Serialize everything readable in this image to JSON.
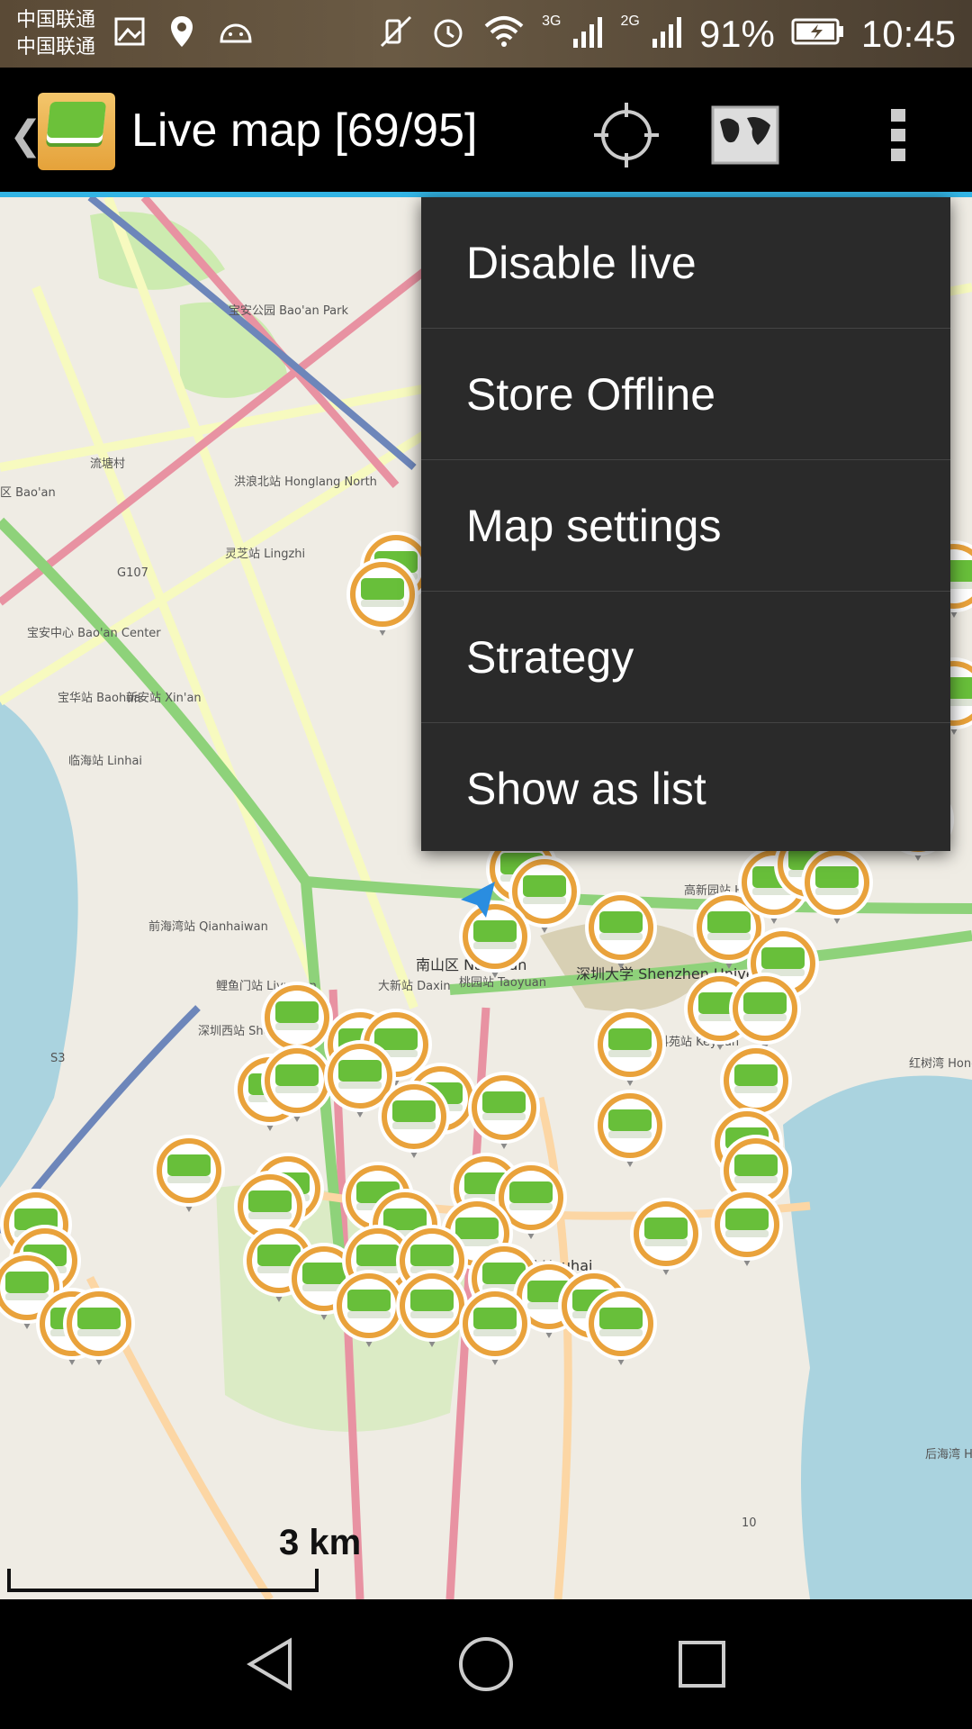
{
  "status_bar": {
    "carrier_line1": "中国联通",
    "carrier_line2": "中国联通",
    "network_3g": "3G",
    "network_2g": "2G",
    "battery": "91%",
    "time": "10:45",
    "icons_left": [
      "gallery-icon",
      "location-pin-icon",
      "android-icon"
    ],
    "icons_right": [
      "mute-icon",
      "alarm-icon",
      "wifi-icon",
      "signal-3g-icon",
      "signal-2g-icon",
      "battery-icon"
    ]
  },
  "action_bar": {
    "title": "Live map [69/95]",
    "icons": [
      "back-caret-icon",
      "app-logo-icon",
      "my-location-icon",
      "map-source-icon",
      "overflow-menu-icon"
    ]
  },
  "overflow_menu": {
    "items": [
      {
        "label": "Disable live"
      },
      {
        "label": "Store Offline"
      },
      {
        "label": "Map settings"
      },
      {
        "label": "Strategy"
      },
      {
        "label": "Show as list"
      }
    ]
  },
  "map": {
    "scale_label": "3 km",
    "place_labels": {
      "houhai": "后海 Houhai",
      "nanshan": "南山区 Nanshan",
      "shenzhen_university": "深圳大学 Shenzhen University",
      "liutang": "流塘村",
      "baoan_park": "宝安公园 Bao'an Park",
      "shenzhen_west": "深圳西站 Shenzhen West Railway",
      "qianhaiwan": "前海湾站 Qianhaiwan",
      "baoan": "区 Bao'an",
      "hongshuwan": "红树湾 Hongshuwan",
      "hitech_park": "高新园站 Hi-Tech Park",
      "daxin": "大新站 Daxin",
      "liyumen": "鲤鱼门站 Liyumen",
      "keyuan": "科苑站 Keyuan",
      "taoyuan": "桃园站 Taoyuan",
      "baoan_center": "宝安中心 Bao'an Center",
      "linhai": "临海站 Linhai",
      "baohua": "宝华站 Baohua",
      "xinan": "新安站 Xin'an",
      "lingzhi": "灵芝站 Lingzhi",
      "honglang_north": "洪浪北站 Honglang North",
      "houhai_bay": "后海湾 Houhai Bay",
      "road_g107": "G107",
      "road_s3": "S3",
      "road_10": "10"
    }
  },
  "nav_bar": {
    "icons": [
      "back-nav-icon",
      "home-nav-icon",
      "recents-nav-icon"
    ]
  }
}
